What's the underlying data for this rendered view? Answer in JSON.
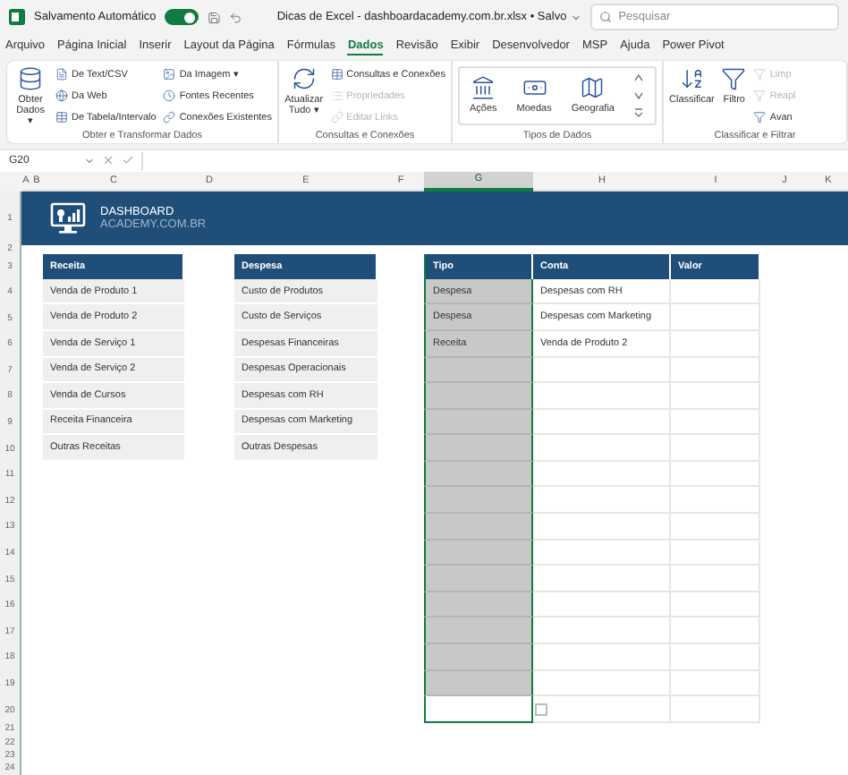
{
  "title_bar": {
    "autosave_label": "Salvamento Automático",
    "autosave_on": true,
    "file_title": "Dicas de Excel - dashboardacademy.com.br.xlsx • Salvo",
    "search_placeholder": "Pesquisar"
  },
  "menu_tabs": [
    {
      "label": "Arquivo",
      "selected": false
    },
    {
      "label": "Página Inicial",
      "selected": false
    },
    {
      "label": "Inserir",
      "selected": false
    },
    {
      "label": "Layout da Página",
      "selected": false
    },
    {
      "label": "Fórmulas",
      "selected": false
    },
    {
      "label": "Dados",
      "selected": true
    },
    {
      "label": "Revisão",
      "selected": false
    },
    {
      "label": "Exibir",
      "selected": false
    },
    {
      "label": "Desenvolvedor",
      "selected": false
    },
    {
      "label": "MSP",
      "selected": false
    },
    {
      "label": "Ajuda",
      "selected": false
    },
    {
      "label": "Power Pivot",
      "selected": false
    }
  ],
  "ribbon": [
    {
      "kind": "get",
      "label": "Obter e Transformar Dados",
      "large": [
        {
          "label": "Obter Dados ▾"
        }
      ],
      "small": [
        {
          "label": "De Text/CSV",
          "disabled": false
        },
        {
          "label": "Da Web",
          "disabled": false
        },
        {
          "label": "De Tabela/Intervalo",
          "disabled": false
        },
        {
          "label": "Da Imagem ▾",
          "disabled": false
        },
        {
          "label": "Fontes Recentes",
          "disabled": false
        },
        {
          "label": "Conexões Existentes",
          "disabled": false
        }
      ]
    },
    {
      "kind": "queries",
      "label": "Consultas e Conexões",
      "large": [
        {
          "label": "Atualizar Tudo ▾"
        }
      ],
      "small": [
        {
          "label": "Consultas e Conexões",
          "disabled": false
        },
        {
          "label": "Propriedades",
          "disabled": true
        },
        {
          "label": "Editar Links",
          "disabled": true
        }
      ]
    },
    {
      "kind": "gallery",
      "label": "Tipos de Dados",
      "large": [
        {
          "label": "Ações"
        },
        {
          "label": "Moedas"
        },
        {
          "label": "Geografia"
        }
      ]
    },
    {
      "kind": "sort",
      "label": "Classificar e Filtrar",
      "large": [
        {
          "label": "Classificar"
        },
        {
          "label": "Filtro"
        }
      ],
      "small": [
        {
          "label": "Limp",
          "disabled": true
        },
        {
          "label": "Reapl",
          "disabled": true
        },
        {
          "label": "Avan",
          "disabled": false
        }
      ]
    }
  ],
  "formula_bar": {
    "name_box": "G20"
  },
  "columns": [
    {
      "label": "A",
      "selected": false
    },
    {
      "label": "B",
      "selected": false
    },
    {
      "label": "C",
      "selected": false
    },
    {
      "label": "D",
      "selected": false
    },
    {
      "label": "E",
      "selected": false
    },
    {
      "label": "F",
      "selected": false
    },
    {
      "label": "G",
      "selected": true
    },
    {
      "label": "H",
      "selected": false
    },
    {
      "label": "I",
      "selected": false
    },
    {
      "label": "J",
      "selected": false
    },
    {
      "label": "K",
      "selected": false
    }
  ],
  "row_numbers": [
    "1",
    "2",
    "3",
    "4",
    "5",
    "6",
    "7",
    "8",
    "9",
    "10",
    "11",
    "12",
    "13",
    "14",
    "15",
    "16",
    "17",
    "18",
    "19",
    "20",
    "21",
    "22",
    "23",
    "24"
  ],
  "banner": {
    "line_1": "DASHBOARD",
    "line_2": "ACADEMY.COM.BR"
  },
  "receita": {
    "header": "Receita",
    "items": [
      "Venda de Produto 1",
      "Venda de Produto 2",
      "Venda de Serviço 1",
      "Venda de Serviço 2",
      "Venda de Cursos",
      "Receita Financeira",
      "Outras Receitas"
    ]
  },
  "despesa": {
    "header": "Despesa",
    "items": [
      "Custo de Produtos",
      "Custo de Serviços",
      "Despesas Financeiras",
      "Despesas Operacionais",
      "Despesas com RH",
      "Despesas com Marketing",
      "Outras Despesas"
    ]
  },
  "entries": {
    "columns": [
      "Tipo",
      "Conta",
      "Valor"
    ],
    "rows": [
      {
        "tipo": "Despesa",
        "conta": "Despesas com RH",
        "active": false
      },
      {
        "tipo": "Despesa",
        "conta": "Despesas com Marketing",
        "active": false
      },
      {
        "tipo": "Receita",
        "conta": "Venda de Produto 2",
        "active": false
      },
      {
        "active": false
      },
      {
        "active": false
      },
      {
        "active": false
      },
      {
        "active": false
      },
      {
        "active": false
      },
      {
        "active": false
      },
      {
        "active": false
      },
      {
        "active": false
      },
      {
        "active": false
      },
      {
        "active": false
      },
      {
        "active": false
      },
      {
        "active": false
      },
      {
        "active": false
      },
      {
        "active": true
      }
    ]
  }
}
